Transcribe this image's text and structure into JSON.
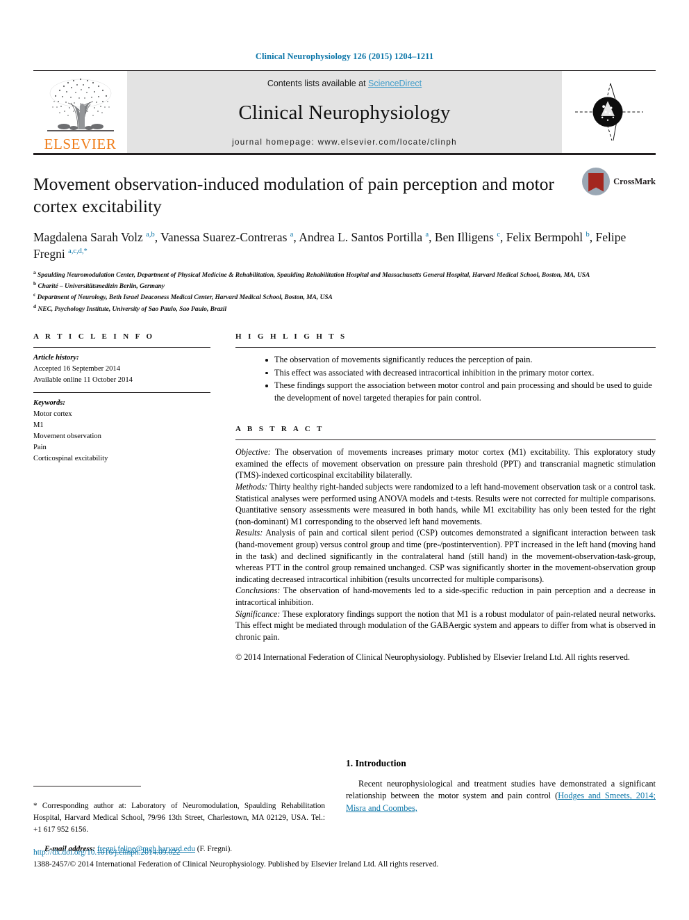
{
  "running_head": "Clinical Neurophysiology 126 (2015) 1204–1211",
  "masthead": {
    "contents_prefix": "Contents lists available at ",
    "sciencedirect": "ScienceDirect",
    "journal_name": "Clinical Neurophysiology",
    "homepage": "journal homepage: www.elsevier.com/locate/clinph",
    "publisher_wordmark": "ELSEVIER",
    "elsevier_orange": "#ef7d1a",
    "sciencedirect_blue": "#3f9cc9"
  },
  "crossmark": {
    "label": "CrossMark"
  },
  "article": {
    "title": "Movement observation-induced modulation of pain perception and motor cortex excitability",
    "authors_html": "Magdalena Sarah Volz <sup>a,b</sup>, Vanessa Suarez-Contreras <sup>a</sup>, Andrea L. Santos Portilla <sup>a</sup>, Ben Illigens <sup>c</sup>, Felix Bermpohl <sup>b</sup>, Felipe Fregni <sup>a,c,d,</sup><sup class=\"star\">*</sup>",
    "affiliations": [
      "<sup>a</sup> Spaulding Neuromodulation Center, Department of Physical Medicine &amp; Rehabilitation, Spaulding Rehabilitation Hospital and Massachusetts General Hospital, Harvard Medical School, Boston, MA, USA",
      "<sup>b</sup> Charité – Universitätsmedizin Berlin, Germany",
      "<sup>c</sup> Department of Neurology, Beth Israel Deaconess Medical Center, Harvard Medical School, Boston, MA, USA",
      "<sup>d</sup> NEC, Psychology Institute, University of Sao Paulo, Sao Paulo, Brazil"
    ]
  },
  "article_info": {
    "heading": "A R T I C L E   I N F O",
    "history_label": "Article history:",
    "history": [
      "Accepted 16 September 2014",
      "Available online 11 October 2014"
    ],
    "keywords_label": "Keywords:",
    "keywords": [
      "Motor cortex",
      "M1",
      "Movement observation",
      "Pain",
      "Corticospinal excitability"
    ]
  },
  "highlights": {
    "heading": "H I G H L I G H T S",
    "items": [
      "The observation of movements significantly reduces the perception of pain.",
      "This effect was associated with decreased intracortical inhibition in the primary motor cortex.",
      "These findings support the association between motor control and pain processing and should be used to guide the development of novel targeted therapies for pain control."
    ]
  },
  "abstract": {
    "heading": "A B S T R A C T",
    "sections": [
      {
        "label": "Objective:",
        "text": " The observation of movements increases primary motor cortex (M1) excitability. This exploratory study examined the effects of movement observation on pressure pain threshold (PPT) and transcranial magnetic stimulation (TMS)-indexed corticospinal excitability bilaterally."
      },
      {
        "label": "Methods:",
        "text": " Thirty healthy right-handed subjects were randomized to a left hand-movement observation task or a control task. Statistical analyses were performed using ANOVA models and t-tests. Results were not corrected for multiple comparisons. Quantitative sensory assessments were measured in both hands, while M1 excitability has only been tested for the right (non-dominant) M1 corresponding to the observed left hand movements."
      },
      {
        "label": "Results:",
        "text": " Analysis of pain and cortical silent period (CSP) outcomes demonstrated a significant interaction between task (hand-movement group) versus control group and time (pre-/postintervention). PPT increased in the left hand (moving hand in the task) and declined significantly in the contralateral hand (still hand) in the movement-observation-task-group, whereas PTT in the control group remained unchanged. CSP was significantly shorter in the movement-observation group indicating decreased intracortical inhibition (results uncorrected for multiple comparisons)."
      },
      {
        "label": "Conclusions:",
        "text": " The observation of hand-movements led to a side-specific reduction in pain perception and a decrease in intracortical inhibition."
      },
      {
        "label": "Significance:",
        "text": " These exploratory findings support the notion that M1 is a robust modulator of pain-related neural networks. This effect might be mediated through modulation of the GABAergic system and appears to differ from what is observed in chronic pain."
      }
    ],
    "copyright": "© 2014 International Federation of Clinical Neurophysiology. Published by Elsevier Ireland Ltd. All rights reserved."
  },
  "correspondence": {
    "star": "*",
    "text": " Corresponding author at: Laboratory of Neuromodulation, Spaulding Rehabilitation Hospital, Harvard Medical School, 79/96 13th Street, Charlestown, MA 02129, USA. Tel.: +1 617 952 6156.",
    "email_label": "E-mail address:",
    "email": "fregni.felipe@mgh.harvard.edu",
    "email_suffix": " (F. Fregni)."
  },
  "introduction": {
    "heading": "1. Introduction",
    "paragraph_prefix": "Recent neurophysiological and treatment studies have demonstrated a significant relationship between the motor system and pain control (",
    "citation": "Hodges and Smeets, 2014; Misra and Coombes,"
  },
  "footer": {
    "doi": "http://dx.doi.org/10.1016/j.clinph.2014.09.022",
    "issn_line": "1388-2457/© 2014 International Federation of Clinical Neurophysiology. Published by Elsevier Ireland Ltd. All rights reserved."
  }
}
